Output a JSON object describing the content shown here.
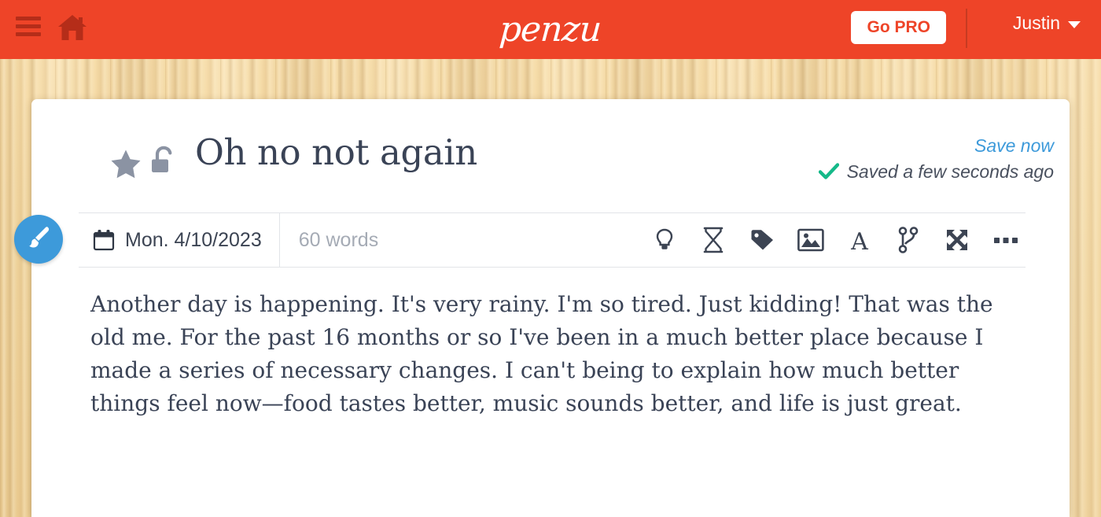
{
  "header": {
    "menu_icon": "hamburger-menu-icon",
    "home_icon": "home-icon",
    "logo_text": "penzu",
    "go_pro_label": "Go PRO",
    "user_name": "Justin",
    "caret_icon": "chevron-down-icon",
    "brand_color": "#EE4428",
    "go_pro_text_color": "#EE4428"
  },
  "entry": {
    "star_icon": "star-icon",
    "lock_icon": "unlocked-padlock-icon",
    "title": "Oh no not again",
    "save_now_label": "Save now",
    "saved_status": "Saved a few seconds ago",
    "check_icon": "green-check-icon",
    "save_link_color": "#3D9ADA",
    "check_color": "#15B989"
  },
  "toolbar": {
    "calendar_icon": "calendar-icon",
    "date": "Mon. 4/10/2023",
    "word_count": "60 words",
    "icons": [
      {
        "name": "lightbulb-icon",
        "label": "Inspiration"
      },
      {
        "name": "hourglass-icon",
        "label": "Time"
      },
      {
        "name": "tag-icon",
        "label": "Tags"
      },
      {
        "name": "image-icon",
        "label": "Insert image"
      },
      {
        "name": "font-icon",
        "label": "Font"
      },
      {
        "name": "branch-icon",
        "label": "Share"
      },
      {
        "name": "expand-icon",
        "label": "Fullscreen"
      },
      {
        "name": "ellipsis-icon",
        "label": "More options"
      }
    ]
  },
  "body": {
    "text": "Another day is happening. It's very rainy. I'm so tired. Just kidding! That was the old me. For the past 16 months or so I've been in a much better place because I made a series of necessary changes. I can't being to explain how much better things feel now—food tastes better, music sounds better, and life is just great."
  },
  "compose": {
    "brush_icon": "paintbrush-icon",
    "color": "#3D9ADA"
  }
}
